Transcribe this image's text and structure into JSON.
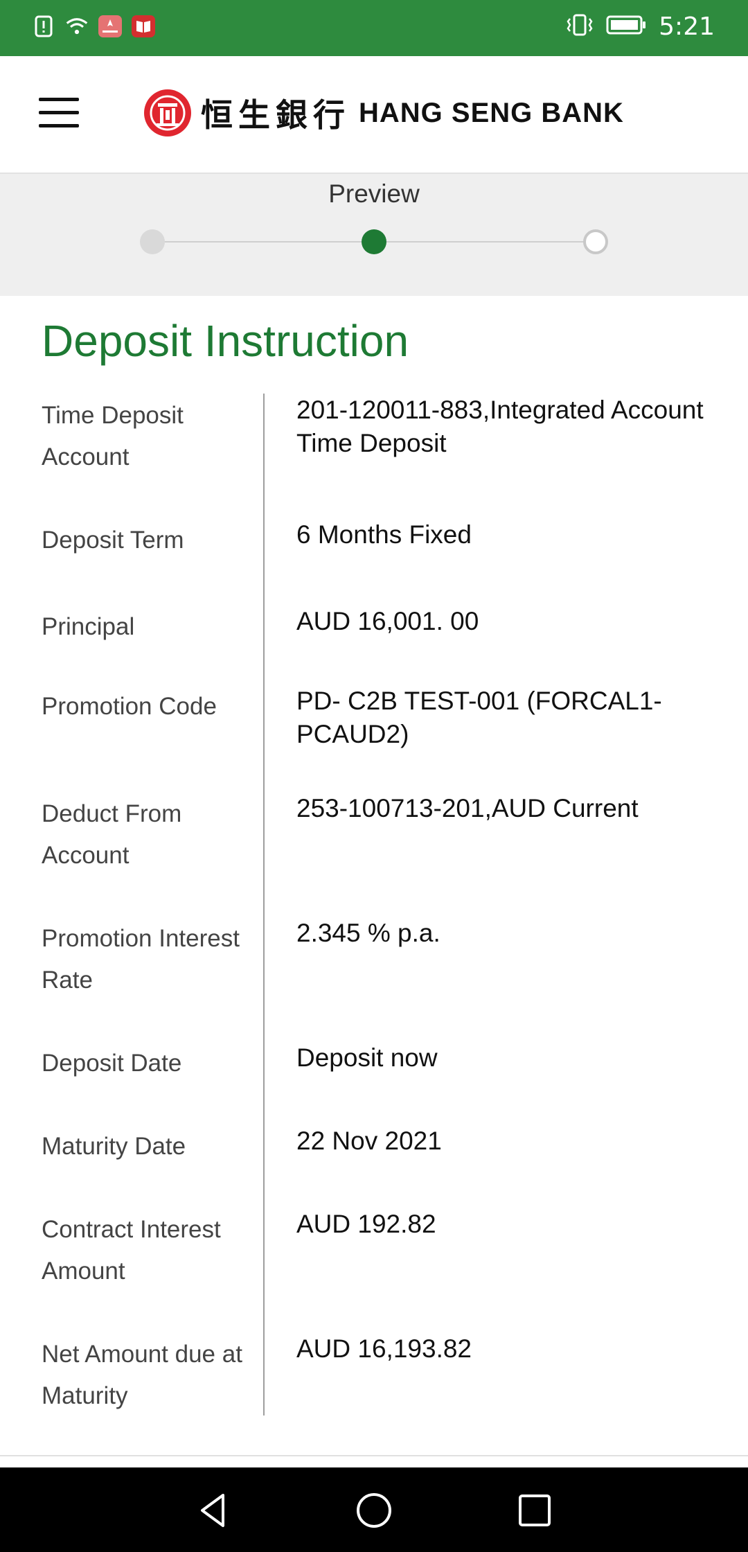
{
  "status_bar": {
    "time": "5:21",
    "left_icons": [
      "alert-icon",
      "wifi-icon",
      "huawei-icon",
      "book-icon"
    ],
    "right_icons": [
      "vibrate-icon",
      "battery-icon"
    ],
    "bar_color": "#2e8b3e"
  },
  "header": {
    "logo_cn": "恒生銀行",
    "logo_en": "HANG SENG BANK"
  },
  "stepper": {
    "title": "Preview",
    "current_step": 2,
    "total_steps": 3
  },
  "section": {
    "title": "Deposit Instruction"
  },
  "details": [
    {
      "label": "Time Deposit Account",
      "value": "201-120011-883,Integrated Account Time Deposit"
    },
    {
      "label": "Deposit Term",
      "value": "6 Months Fixed"
    },
    {
      "label": "Principal",
      "value": "AUD 16,001. 00"
    },
    {
      "label": "Promotion Code",
      "value": "PD- C2B TEST-001 (FORCAL1-PCAUD2)"
    },
    {
      "label": "Deduct From Account",
      "value": "253-100713-201,AUD Current"
    },
    {
      "label": "Promotion Interest Rate",
      "value": "2.345 % p.a."
    },
    {
      "label": "Deposit Date",
      "value": "Deposit now"
    },
    {
      "label": "Maturity Date",
      "value": "22 Nov 2021"
    },
    {
      "label": "Contract Interest Amount",
      "value": "AUD 192.82"
    },
    {
      "label": "Net Amount due at Maturity",
      "value": "AUD 16,193.82"
    }
  ],
  "colors": {
    "accent_green": "#1e7a34",
    "status_green": "#2e8b3e"
  },
  "nav": {
    "icons": [
      "back-icon",
      "home-icon",
      "recents-icon"
    ]
  }
}
